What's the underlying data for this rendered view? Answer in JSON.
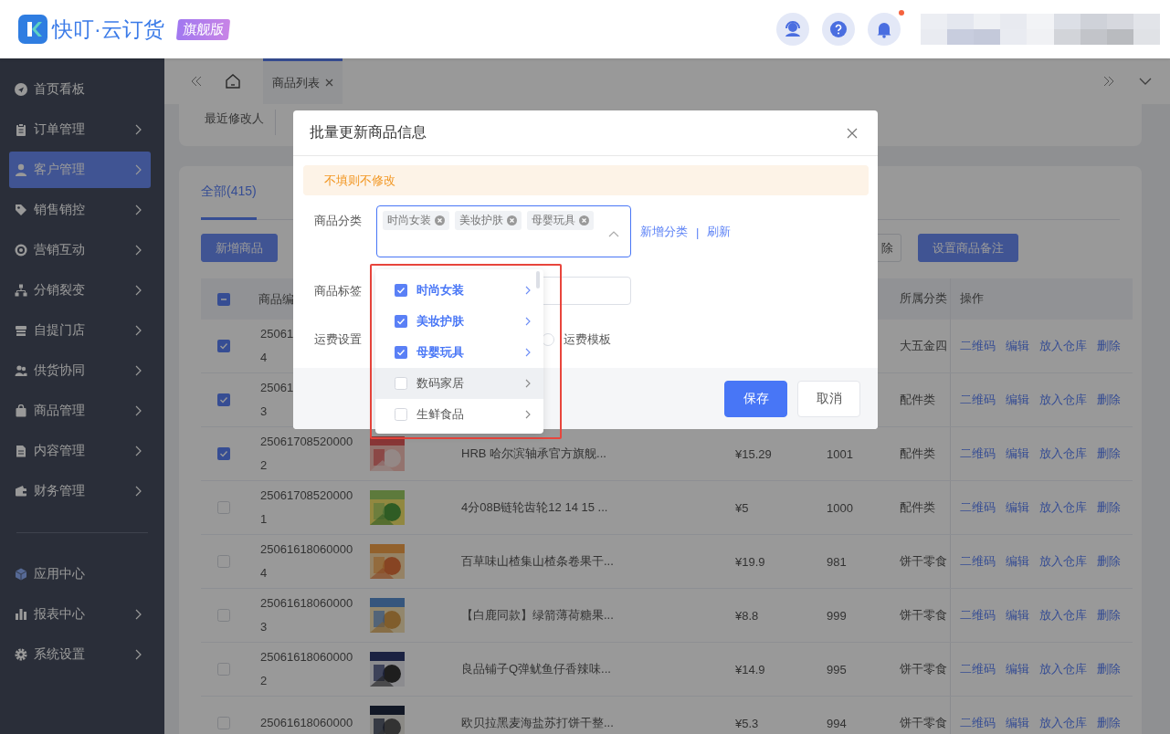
{
  "header": {
    "logo_text": "快叮·云订货",
    "edition_badge": "旗舰版",
    "unread_notifications": true
  },
  "sidebar": {
    "items": [
      {
        "label": "首页看板",
        "expandable": false,
        "selected": false
      },
      {
        "label": "订单管理",
        "expandable": true,
        "selected": false
      },
      {
        "label": "客户管理",
        "expandable": true,
        "selected": true
      },
      {
        "label": "销售销控",
        "expandable": true,
        "selected": false
      },
      {
        "label": "营销互动",
        "expandable": true,
        "selected": false
      },
      {
        "label": "分销裂变",
        "expandable": true,
        "selected": false
      },
      {
        "label": "自提门店",
        "expandable": true,
        "selected": false
      },
      {
        "label": "供货协同",
        "expandable": true,
        "selected": false
      },
      {
        "label": "商品管理",
        "expandable": true,
        "selected": false
      },
      {
        "label": "内容管理",
        "expandable": true,
        "selected": false
      },
      {
        "label": "财务管理",
        "expandable": true,
        "selected": false
      }
    ],
    "bottom_items": [
      {
        "label": "应用中心",
        "expandable": false,
        "selected": false
      },
      {
        "label": "报表中心",
        "expandable": true,
        "selected": false
      },
      {
        "label": "系统设置",
        "expandable": true,
        "selected": false
      }
    ]
  },
  "tab_bar": {
    "tabs": [
      {
        "label": "商品列表",
        "selected": true
      }
    ]
  },
  "filter": {
    "label": "最近修改人"
  },
  "list": {
    "tabs": [
      {
        "label": "全部(415)",
        "selected": true
      }
    ],
    "buttons": [
      {
        "label": "新增商品",
        "kind": "primary"
      },
      {
        "label": "除",
        "kind": "default"
      },
      {
        "label": "设置商品备注",
        "kind": "primary"
      }
    ],
    "table": {
      "select_all": {
        "indeterminate": true
      },
      "header": {
        "code": "商品编",
        "category": "所属分类",
        "actions": "操作"
      },
      "rows": [
        {
          "checked": true,
          "code": "25061\n4",
          "category": "大五金四",
          "actions": [
            "二维码",
            "编辑",
            "放入仓库",
            "删除"
          ]
        },
        {
          "checked": true,
          "code": "25061\n3",
          "category": "配件类",
          "actions": [
            "二维码",
            "编辑",
            "放入仓库",
            "删除"
          ]
        },
        {
          "checked": true,
          "code": "25061708520000\n2",
          "image": {
            "kind": "picture"
          },
          "name": "HRB 哈尔滨轴承官方旗舰...",
          "price": "¥15.29",
          "stock": "1001",
          "category": "配件类",
          "actions": [
            "二维码",
            "编辑",
            "放入仓库",
            "删除"
          ]
        },
        {
          "checked": false,
          "code": "25061708520000\n1",
          "image": {
            "kind": "picture"
          },
          "name": "4分08B链轮齿轮12 14 15 ...",
          "price": "¥5",
          "stock": "1000",
          "category": "配件类",
          "actions": [
            "二维码",
            "编辑",
            "放入仓库",
            "删除"
          ]
        },
        {
          "checked": false,
          "code": "25061618060000\n4",
          "image": {
            "kind": "picture"
          },
          "name": "百草味山楂集山楂条卷果干...",
          "price": "¥19.9",
          "stock": "981",
          "category": "饼干零食",
          "actions": [
            "二维码",
            "编辑",
            "放入仓库",
            "删除"
          ]
        },
        {
          "checked": false,
          "code": "25061618060000\n3",
          "image": {
            "kind": "picture"
          },
          "name": "【白鹿同款】绿箭薄荷糖果...",
          "price": "¥8.8",
          "stock": "999",
          "category": "饼干零食",
          "actions": [
            "二维码",
            "编辑",
            "放入仓库",
            "删除"
          ]
        },
        {
          "checked": false,
          "code": "25061618060000\n2",
          "image": {
            "kind": "picture"
          },
          "name": "良品铺子Q弹鱿鱼仔香辣味...",
          "price": "¥14.9",
          "stock": "995",
          "category": "饼干零食",
          "actions": [
            "二维码",
            "编辑",
            "放入仓库",
            "删除"
          ]
        },
        {
          "checked": false,
          "code": "25061618060000",
          "image": {
            "kind": "picture"
          },
          "name": "欧贝拉黑麦海盐苏打饼干整...",
          "price": "¥5.3",
          "stock": "994",
          "category": "饼干零食",
          "actions": [
            "二维码",
            "编辑",
            "放入仓库",
            "删除"
          ]
        }
      ]
    }
  },
  "modal": {
    "title": "批量更新商品信息",
    "alert": "不填则不修改",
    "fields": [
      {
        "kind": "tag_select",
        "label": "商品分类",
        "tags": [
          "时尚女装",
          "美妆护肤",
          "母婴玩具"
        ],
        "expanded": true,
        "links": [
          "新增分类",
          "刷新"
        ],
        "link_separator": "|"
      },
      {
        "kind": "input",
        "label": "商品标签"
      },
      {
        "kind": "radio",
        "label": "运费设置",
        "options": [
          {
            "label": "运费模板",
            "selected": false
          }
        ]
      }
    ],
    "buttons": [
      {
        "label": "保存",
        "kind": "primary"
      },
      {
        "label": "取消",
        "kind": "default"
      }
    ]
  },
  "dropdown": {
    "options": [
      {
        "label": "时尚女装",
        "checked": true,
        "highlighted": false
      },
      {
        "label": "美妆护肤",
        "checked": true,
        "highlighted": false
      },
      {
        "label": "母婴玩具",
        "checked": true,
        "highlighted": false
      },
      {
        "label": "数码家居",
        "checked": false,
        "highlighted": true
      },
      {
        "label": "生鲜食品",
        "checked": false,
        "highlighted": false
      }
    ]
  }
}
